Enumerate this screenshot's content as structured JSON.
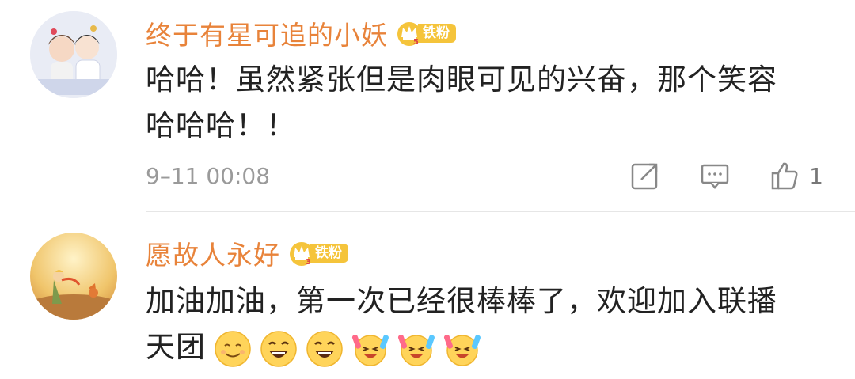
{
  "comments": [
    {
      "username": "终于有星可追的小妖",
      "badge": {
        "level": "5",
        "label": "铁粉"
      },
      "text_line1": "哈哈！虽然紧张但是肉眼可见的兴奋，那个笑容",
      "text_line2": "哈哈哈！！",
      "timestamp": "9–11 00:08",
      "like_count": "1"
    },
    {
      "username": "愿故人永好",
      "badge": {
        "level": "3",
        "label": "铁粉"
      },
      "text_line1": "加油加油，第一次已经很棒棒了，欢迎加入联播",
      "text_line2": "天团",
      "emojis": [
        "smile-emoji",
        "laugh-emoji",
        "laugh-emoji",
        "cheer-emoji",
        "cheer-emoji",
        "cheer-emoji"
      ]
    }
  ],
  "colors": {
    "username": "#e8833a",
    "badge": "#f5c43b",
    "text": "#222222",
    "meta": "#9a9a9a"
  }
}
